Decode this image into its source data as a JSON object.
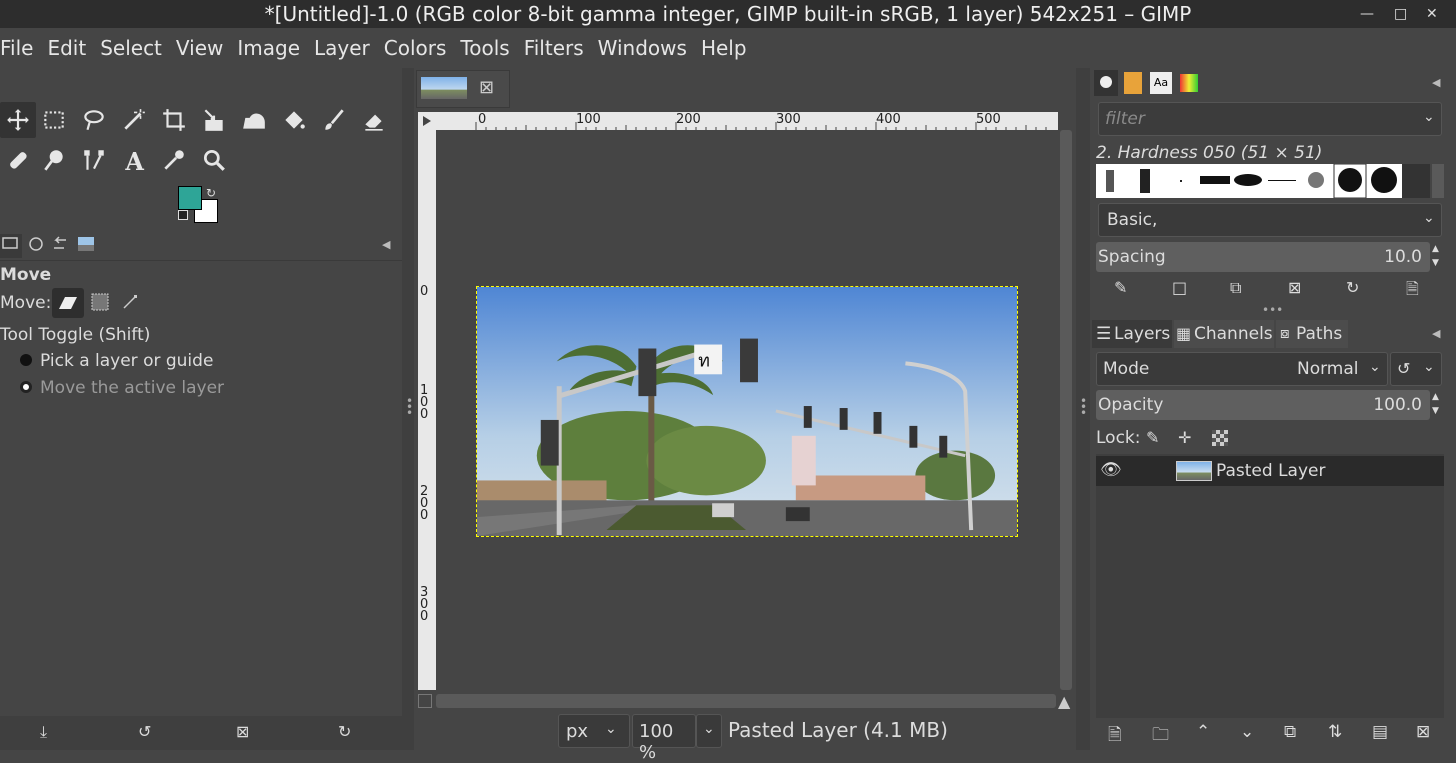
{
  "window": {
    "title": "*[Untitled]-1.0 (RGB color 8-bit gamma integer, GIMP built-in sRGB, 1 layer) 542x251 – GIMP"
  },
  "menu": [
    "File",
    "Edit",
    "Select",
    "View",
    "Image",
    "Layer",
    "Colors",
    "Tools",
    "Filters",
    "Windows",
    "Help"
  ],
  "colors": {
    "fg": "#2ea597",
    "bg": "#ffffff",
    "accent": "#ffff00"
  },
  "toolbox": {
    "tools": [
      "move-tool",
      "rect-select-tool",
      "lasso-tool",
      "fuzzy-select-tool",
      "crop-tool",
      "scale-tool",
      "warp-tool",
      "bucket-fill-tool",
      "paintbrush-tool",
      "eraser-tool",
      "heal-tool",
      "smudge-tool",
      "path-tool",
      "text-tool",
      "color-picker-tool",
      "zoom-tool"
    ]
  },
  "tool_options": {
    "title": "Move",
    "move_label": "Move:",
    "toggle_label": "Tool Toggle  (Shift)",
    "option1": "Pick a layer or guide",
    "option2": "Move the active layer"
  },
  "image_tab": {
    "close": "⊠"
  },
  "rulers": {
    "h": [
      "0",
      "100",
      "200",
      "300",
      "400",
      "500"
    ],
    "v": [
      "0",
      "100",
      "200",
      "300"
    ]
  },
  "status": {
    "unit": "px",
    "zoom": "100 %",
    "layer_info": "Pasted Layer (4.1 MB)"
  },
  "brushes": {
    "filter_placeholder": "filter",
    "brush_name": "2. Hardness 050 (51 × 51)",
    "preset": "Basic,",
    "spacing_label": "Spacing",
    "spacing_value": "10.0"
  },
  "layers": {
    "tabs": [
      "Layers",
      "Channels",
      "Paths"
    ],
    "mode_label": "Mode",
    "mode_value": "Normal",
    "opacity_label": "Opacity",
    "opacity_value": "100.0",
    "lock_label": "Lock:",
    "layer_name": "Pasted Layer"
  }
}
